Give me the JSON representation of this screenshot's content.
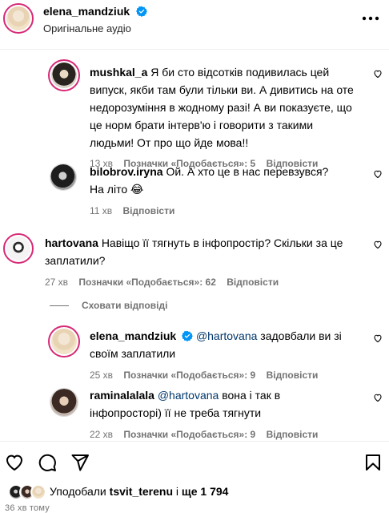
{
  "header": {
    "username": "elena_mandziuk",
    "audio": "Оригінальне аудіо",
    "more_icon": "more-horizontal-icon"
  },
  "comments": [
    {
      "username": "mushkal_a",
      "text": "Я би сто відсотків подивилась цей випуск, якби там були тільки ви. А дивитись на оте недорозуміння в жодному разі! А ви показуєте, що це норм брати інтерв'ю і говорити з такими людьми! От про що йде мова!!",
      "time": "13 хв",
      "likes": "Позначки «Подобається»: 5",
      "reply": "Відповісти"
    },
    {
      "username": "bilobrov.iryna",
      "text": "Ой. А хто це в нас перевзувся? На літо 😂",
      "time": "11 хв",
      "reply": "Відповісти"
    },
    {
      "username": "hartovana",
      "text": "Навіщо її тягнуть в інфопростір? Скільки за це заплатили?",
      "time": "27 хв",
      "likes": "Позначки «Подобається»: 62",
      "reply": "Відповісти"
    }
  ],
  "hide_replies": "Сховати відповіді",
  "replies": [
    {
      "username": "elena_mandziuk",
      "mention": "@hartovana",
      "text": " задовбали ви зі своїм заплатили",
      "time": "25 хв",
      "likes": "Позначки «Подобається»: 9",
      "reply": "Відповісти"
    },
    {
      "username": "raminalalala",
      "mention": "@hartovana",
      "text": " вона і так в інфопросторі) її не треба тягнути",
      "time": "22 хв",
      "likes": "Позначки «Подобається»: 9",
      "reply": "Відповісти"
    }
  ],
  "footer": {
    "liked_prefix": "Уподобали ",
    "liked_user": "tsvit_terenu",
    "liked_mid": " і ",
    "liked_count": "ще 1 794",
    "time_ago": "36 хв тому"
  },
  "colors": {
    "verified": "#0095f6",
    "mention": "#00376b",
    "meta": "#737373",
    "story_ring": "#d62976"
  }
}
